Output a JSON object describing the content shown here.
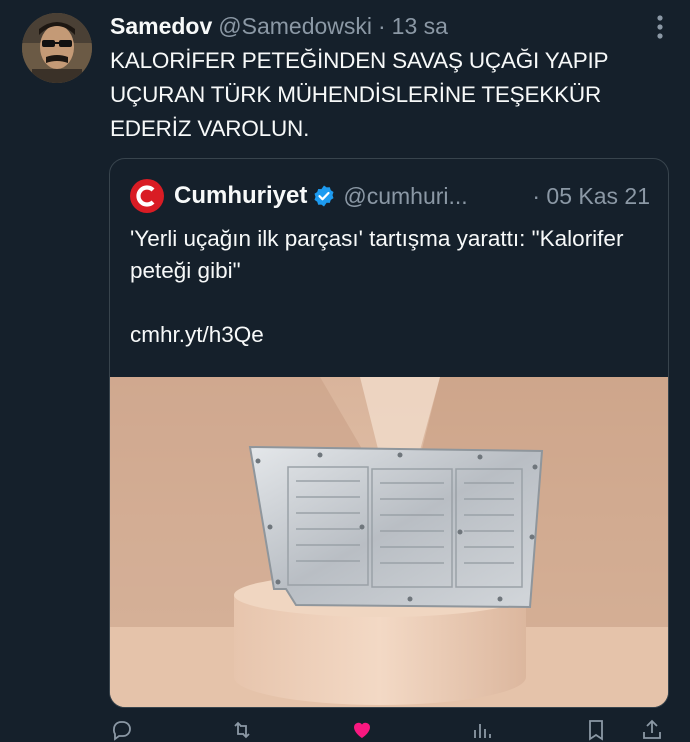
{
  "tweet": {
    "display_name": "Samedov",
    "handle": "@Samedowski",
    "separator": "·",
    "time": "13 sa",
    "text": "KALORİFER PETEĞİNDEN SAVAŞ UÇAĞI YAPIP UÇURAN TÜRK MÜHENDİSLERİNE TEŞEKKÜR EDERİZ VAROLUN."
  },
  "quote": {
    "display_name": "Cumhuriyet",
    "handle": "@cumhuri...",
    "separator": "·",
    "date": "05 Kas 21",
    "text": "'Yerli uçağın ilk parçası' tartışma yarattı: \"Kalorifer peteği gibi\"\n\ncmhr.yt/h3Qe"
  },
  "colors": {
    "background": "#15202b",
    "text": "#f7f9f9",
    "muted": "#8b98a5",
    "border": "#38444d",
    "brand_red": "#d91c24",
    "verified_blue": "#1d9bf0",
    "like_pink": "#f91880"
  },
  "icons": [
    "more-icon",
    "verified-badge-icon",
    "reply-icon",
    "retweet-icon",
    "like-icon",
    "views-icon",
    "bookmark-icon",
    "share-icon"
  ]
}
